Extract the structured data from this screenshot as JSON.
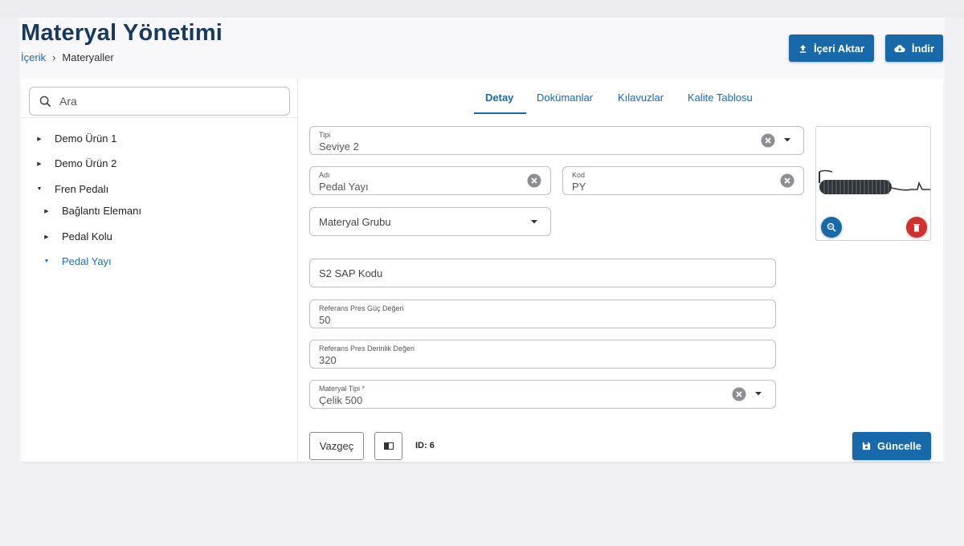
{
  "header": {
    "title": "Materyal Yönetimi",
    "breadcrumb": {
      "parent": "İçerik",
      "separator": "›",
      "current": "Materyaller"
    },
    "import_label": "İçeri Aktar",
    "download_label": "İndir"
  },
  "sidebar": {
    "search_placeholder": "Ara",
    "tree": [
      {
        "label": "Demo Ürün 1",
        "expanded": false,
        "active": false
      },
      {
        "label": "Demo Ürün 2",
        "expanded": false,
        "active": false
      },
      {
        "label": "Fren Pedalı",
        "expanded": true,
        "active": false
      },
      {
        "label": "Bağlantı Elemanı",
        "expanded": false,
        "active": false
      },
      {
        "label": "Pedal Kolu",
        "expanded": false,
        "active": false
      },
      {
        "label": "Pedal Yayı",
        "expanded": true,
        "active": true
      }
    ]
  },
  "tabs": [
    {
      "label": "Detay",
      "active": true
    },
    {
      "label": "Dokümanlar",
      "active": false
    },
    {
      "label": "Kılavuzlar",
      "active": false
    },
    {
      "label": "Kalite Tablosu",
      "active": false
    }
  ],
  "form": {
    "tipi": {
      "label": "Tipi",
      "value": "Seviye 2"
    },
    "adi": {
      "label": "Adı",
      "value": "Pedal Yayı"
    },
    "kod": {
      "label": "Kod",
      "value": "PY"
    },
    "materyal_grubu": {
      "placeholder": "Materyal Grubu"
    },
    "sap_kodu": {
      "placeholder": "S2 SAP Kodu"
    },
    "pres_guc": {
      "label": "Referans Pres Güç Değeri",
      "value": "50"
    },
    "pres_derinlik": {
      "label": "Referans Pres Derinlik Değeri",
      "value": "320"
    },
    "materyal_tipi": {
      "label": "Materyal Tipi *",
      "value": "Çelik 500"
    }
  },
  "footer": {
    "cancel_label": "Vazgeç",
    "id_text": "ID: 6",
    "update_label": "Güncelle"
  },
  "colors": {
    "primary": "#1769aa",
    "danger": "#d32f2f",
    "title": "#173a5e",
    "link": "#1a6aa8"
  }
}
